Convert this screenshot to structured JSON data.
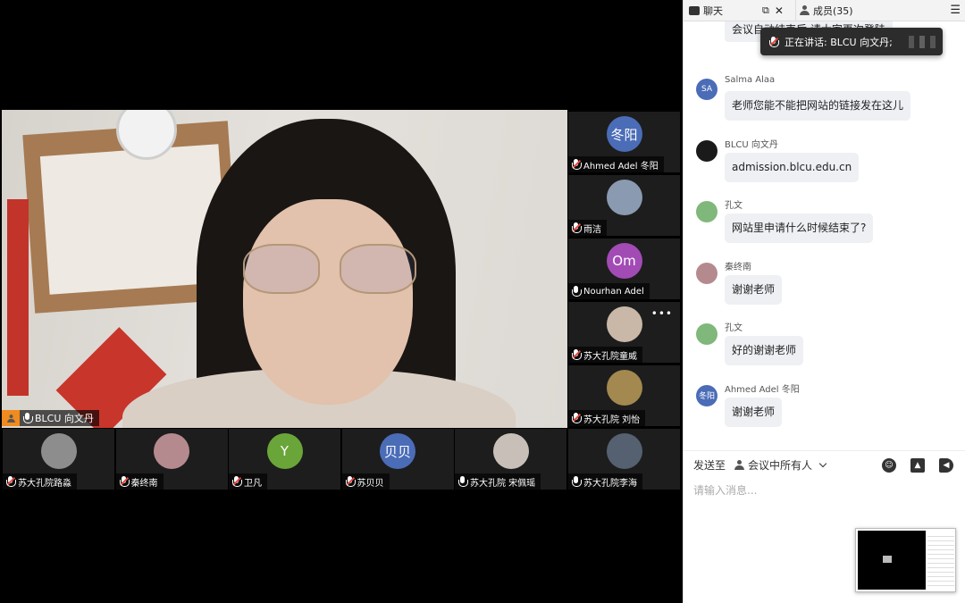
{
  "main_video": {
    "speaker_name": "BLCU 向文丹"
  },
  "side_tiles": [
    {
      "name": "Ahmed Adel 冬阳",
      "avatar_text": "冬阳",
      "avatar_color": "#4b6cb7",
      "muted": true
    },
    {
      "name": "雨洁",
      "avatar_text": "",
      "avatar_color": "#8a9ab0",
      "muted": true
    },
    {
      "name": "Nourhan Adel",
      "avatar_text": "Om",
      "avatar_color": "#a24bb5",
      "muted": false
    },
    {
      "name": "苏大孔院童威",
      "avatar_text": "",
      "avatar_color": "#c9b8a8",
      "muted": true
    },
    {
      "name": "苏大孔院 刘怡",
      "avatar_text": "",
      "avatar_color": "#a3884f",
      "muted": true
    },
    {
      "name": "苏大孔院李海",
      "avatar_text": "",
      "avatar_color": "#556070",
      "muted": false
    }
  ],
  "bottom_tiles": [
    {
      "name": "苏大孔院路淼",
      "avatar_text": "",
      "avatar_color": "#8d8d8d",
      "muted": true
    },
    {
      "name": "秦终南",
      "avatar_text": "",
      "avatar_color": "#b58a8f",
      "muted": true
    },
    {
      "name": "卫凡",
      "avatar_text": "Y",
      "avatar_color": "#6aa539",
      "muted": true
    },
    {
      "name": "苏贝贝",
      "avatar_text": "贝贝",
      "avatar_color": "#4b6cb7",
      "muted": true
    },
    {
      "name": "苏大孔院 宋佩瑶",
      "avatar_text": "",
      "avatar_color": "#c8c0b8",
      "muted": false
    }
  ],
  "chat": {
    "header": {
      "chat_label": "聊天",
      "members_label": "成员(35)"
    },
    "partial_message": "会议自动结束后 请大家再次登陆",
    "speaking_toast": "正在讲话:   BLCU 向文丹;",
    "messages": [
      {
        "sender": "Salma Alaa",
        "avatar_text": "SA",
        "avatar_color": "#4b6cb7",
        "text": "老师您能不能把网站的链接发在这儿"
      },
      {
        "sender": "BLCU 向文丹",
        "avatar_text": "",
        "avatar_color": "#1a1a1a",
        "text": "admission.blcu.edu.cn"
      },
      {
        "sender": "孔文",
        "avatar_text": "",
        "avatar_color": "#7fb87a",
        "text": "网站里申请什么时候结束了?"
      },
      {
        "sender": "秦终南",
        "avatar_text": "",
        "avatar_color": "#b58a8f",
        "text": "谢谢老师"
      },
      {
        "sender": "孔文",
        "avatar_text": "",
        "avatar_color": "#7fb87a",
        "text": "好的谢谢老师"
      },
      {
        "sender": "Ahmed Adel 冬阳",
        "avatar_text": "冬阳",
        "avatar_color": "#4b6cb7",
        "text": "谢谢老师"
      }
    ],
    "send_to_label": "发送至",
    "send_target": "会议中所有人",
    "input_placeholder": "请输入消息..."
  }
}
